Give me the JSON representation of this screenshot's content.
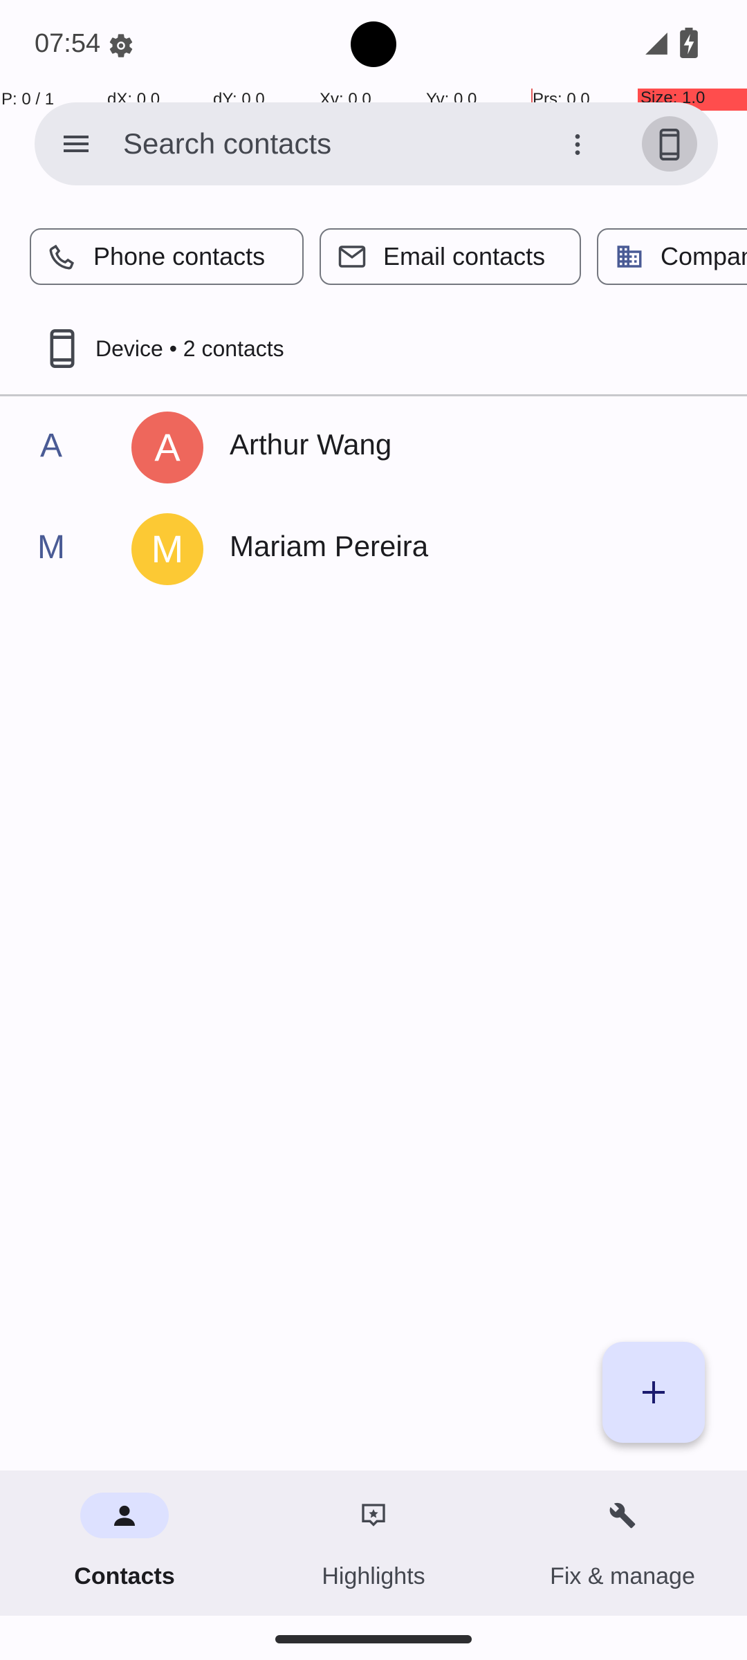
{
  "status_bar": {
    "time": "07:54",
    "icons": [
      "gear-icon",
      "signal-icon",
      "battery-charging-icon"
    ]
  },
  "pointer_overlay": {
    "p": "P: 0 / 1",
    "dx": "dX: 0.0",
    "dy": "dY: 0.0",
    "xv": "Xv: 0.0",
    "yv": "Yv: 0.0",
    "prs": "Prs: 0.0",
    "size": "Size: 1.0"
  },
  "search": {
    "placeholder": "Search contacts",
    "menu_icon": "menu-icon",
    "more_icon": "more-vert-icon",
    "account_icon": "smartphone-icon"
  },
  "chips": [
    {
      "label": "Phone contacts",
      "icon": "phone-icon"
    },
    {
      "label": "Email contacts",
      "icon": "mail-icon"
    },
    {
      "label": "Company",
      "icon": "building-icon"
    }
  ],
  "account": {
    "label": "Device • 2 contacts",
    "icon": "smartphone-icon"
  },
  "contacts": [
    {
      "index": "A",
      "initial": "A",
      "name": "Arthur Wang",
      "avatar_color": "#ee675c"
    },
    {
      "index": "M",
      "initial": "M",
      "name": "Mariam Pereira",
      "avatar_color": "#fcc934"
    }
  ],
  "fab": {
    "icon": "add-icon"
  },
  "bottom_nav": {
    "items": [
      {
        "label": "Contacts",
        "icon": "person-icon",
        "active": true
      },
      {
        "label": "Highlights",
        "icon": "highlights-icon",
        "active": false
      },
      {
        "label": "Fix & manage",
        "icon": "wrench-icon",
        "active": false
      }
    ]
  },
  "colors": {
    "accent": "#dde1ff",
    "index_letter": "#4a5b95",
    "surface": "#fdfbff"
  }
}
